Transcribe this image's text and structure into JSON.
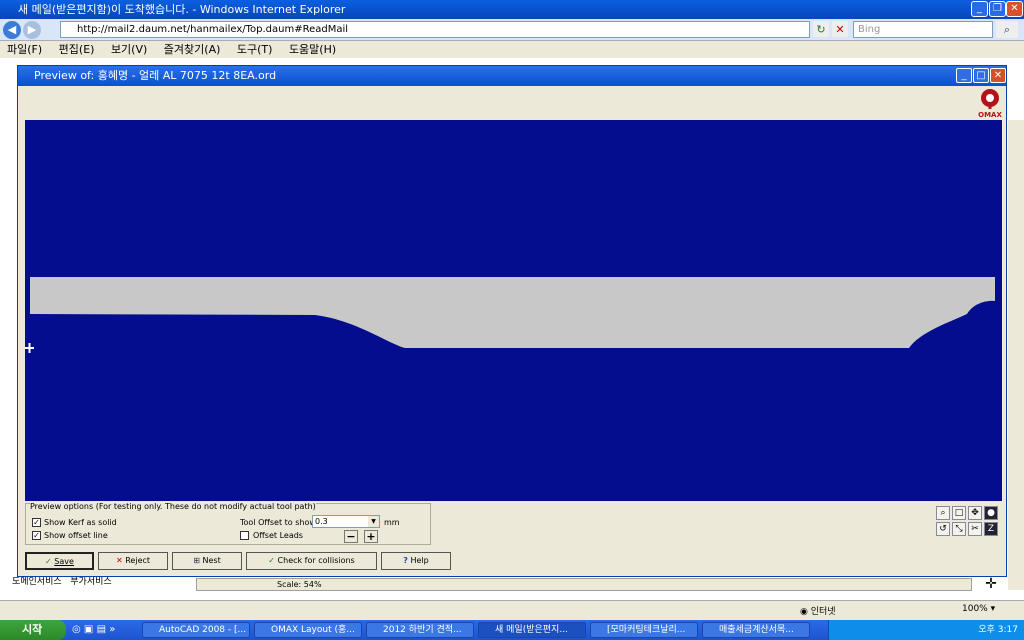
{
  "ie": {
    "title": "새 메일(받은편지함)이 도착했습니다. - Windows Internet Explorer",
    "url": "http://mail2.daum.net/hanmailex/Top.daum#ReadMail",
    "search_placeholder": "Bing",
    "menu": [
      "파일(F)",
      "편집(E)",
      "보기(V)",
      "즐겨찾기(A)",
      "도구(T)",
      "도움말(H)"
    ],
    "page_links": [
      "도메인서비스",
      "부가서비스"
    ],
    "status_zone": "인터넷",
    "zoom": "100%"
  },
  "dialog": {
    "title": "Preview of: 홍혜명 - 얼레 AL 7075 12t 8EA.ord",
    "logo_text": "OMAX",
    "options_caption": "Preview options (For testing only. These do not modify actual tool path)",
    "show_kerf": {
      "label": "Show Kerf as solid",
      "checked": true
    },
    "show_offset": {
      "label": "Show offset line",
      "checked": true
    },
    "tool_offset_label": "Tool Offset to show:",
    "tool_offset_value": "0.3",
    "tool_offset_unit": "mm",
    "offset_leads": {
      "label": "Offset Leads",
      "checked": false
    },
    "minus": "−",
    "plus": "+",
    "buttons": {
      "save": "Save",
      "reject": "Reject",
      "nest": "Nest",
      "check": "Check for collisions",
      "help": "Help"
    },
    "scale": "Scale: 54%"
  },
  "colors": {
    "canvas": "#030d8e",
    "part": "#c8c8c8"
  },
  "taskbar": {
    "start": "시작",
    "tasks": [
      "AutoCAD 2008 - [...",
      "OMAX Layout (홍...",
      "2012 하반기 견적...",
      "새 메일(받은편지...",
      "[모마커팅테크날리...",
      "매출세금계산서목..."
    ],
    "clock": "오후 3:17"
  }
}
